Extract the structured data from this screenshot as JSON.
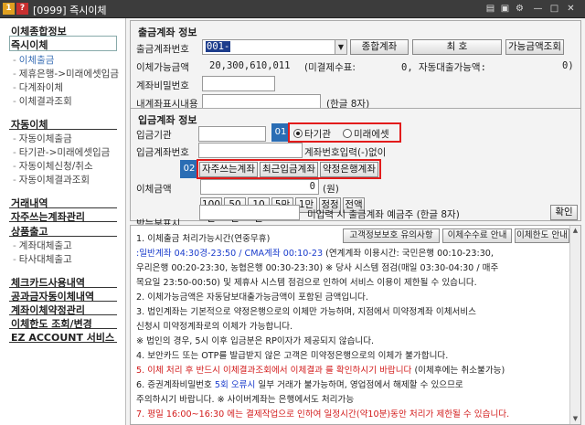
{
  "window": {
    "title": "[0999] 즉시이체",
    "badge1": "1",
    "badge2": "?"
  },
  "sidebar": {
    "section1": "이체종합정보",
    "selected": "즉시이체",
    "items1": [
      "이체출금",
      "제휴은행->미래에셋입금",
      "다계좌이체",
      "이체결과조회"
    ],
    "section2": "자동이체",
    "items2": [
      "자동이체출금",
      "타기관->미래에셋입금",
      "자동이체신청/취소",
      "자동이체결과조회"
    ],
    "section3": "거래내역",
    "section4": "자주쓰는계좌관리",
    "section5": "상품출고",
    "items5": [
      "계좌대체출고",
      "타사대체출고"
    ],
    "bottom": [
      "체크카드사용내역",
      "공과금자동이체내역",
      "계좌이체약정관리",
      "이체한도 조회/변경",
      "EZ ACCOUNT 서비스"
    ]
  },
  "out_panel": {
    "title": "출금계좌 정보",
    "account_label": "출금계좌번호",
    "account_value": "001-",
    "type_button": "종합계좌",
    "name_button": "최  호",
    "available_button": "가능금액조회",
    "available_label": "이체가능금액",
    "available_value": "20,300,610,011",
    "unpaid_label": "(미결제수표:",
    "unpaid_value": "0, 자동대출가능액:",
    "loan_value": "0)",
    "password_label": "계좌비밀번호",
    "memo_label": "내계좌표시내용",
    "memo_hint": "(한글 8자)"
  },
  "in_panel": {
    "title": "입금계좌 정보",
    "bank_label": "입금기관",
    "badge1": "01",
    "radio1": "타기관",
    "radio2": "미래에셋",
    "account_label": "입금계좌번호",
    "account_hint": "계좌번호입력(-)없이",
    "badge2": "02",
    "btn_frequent": "자주쓰는계좌",
    "btn_recent": "최근입금계좌",
    "btn_contract": "약정은행계좌",
    "amount_label": "이체금액",
    "amount_value": "0",
    "amount_unit": "(원)",
    "amount_buttons": [
      "100만",
      "50만",
      "10만",
      "5만",
      "1만",
      "정정",
      "전액"
    ],
    "receiver_label": "받는분표시",
    "receiver_hint": "미입력 시 출금계좌 예금주 (한글 8자)",
    "confirm": "확인"
  },
  "notice": {
    "buttons": [
      "고객정보보호 유의사항",
      "이체수수료 안내",
      "이체한도 안내"
    ],
    "l1": "1. 이체출금 처리가능시간(연중무휴)",
    "l2a": " :일반계좌 04:30경-23:50 / CMA계좌 00:10-23",
    "l2b": " (연계계좌 이용시간: 국민은행 00:10-23:30,",
    "l3": "   우리은행 00:20-23:30, 농협은행 00:30-23:30) ※ 당사 시스템 점검(매일 03:30-04:30 / 매주",
    "l4": "   목요일 23:50-00:50) 및 제휴사 시스템 점검으로 인하여 서비스 이용이 제한될 수 있습니다.",
    "l5": "2. 이체가능금액은 자동담보대출가능금액이 포함된 금액입니다.",
    "l6": "3. 법인계좌는 기본적으로 약정은행으로의 이체만 가능하며, 지점에서 미약정계좌 이체서비스",
    "l7": "   신청시 미약정계좌로의 이체가 가능합니다.",
    "l8": "   ※ 법인의 경우, 5시 이후 입금분은 RP이자가 제공되지 않습니다.",
    "l9": "4. 보안카드 또는 OTP를 발급받지 않은 고객은 미약정은행으로의 이체가 불가합니다.",
    "l10a": "5. 이체 처리 후 반드시 이체결과조회에서 이체결과  를 확인하시기 바랍니다",
    "l10b": " (이체후에는 취소불가능)",
    "l11a": "6. 증권계좌비밀번호 ",
    "l11b": "5회 오류시",
    "l11c": "  일부 거래가 불가능하며, 영업점에서 해제할 수 있으므로",
    "l12": "   주의하시기 바랍니다. ※ 사이버계좌는 은행에서도 처리가능",
    "l13": "7. 평일 16:00~16:30 에는 결제작업으로 인하여 일정시간(약10분)동안 처리가 제한될 수 있습니다."
  },
  "colors": {
    "accent_blue": "#2a6db4",
    "highlight_red": "#e21b1b"
  }
}
